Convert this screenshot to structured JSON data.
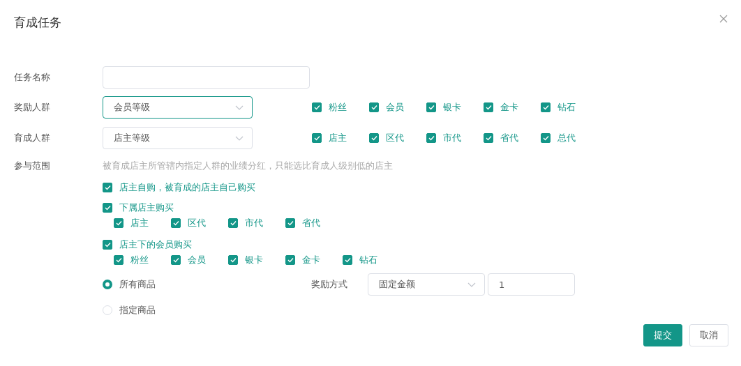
{
  "title": "育成任务",
  "task_name": {
    "label": "任务名称"
  },
  "reward_group": {
    "label": "奖励人群",
    "value": "会员等级",
    "focused": true,
    "options": [
      {
        "label": "粉丝",
        "checked": true
      },
      {
        "label": "会员",
        "checked": true
      },
      {
        "label": "银卡",
        "checked": true
      },
      {
        "label": "金卡",
        "checked": true
      },
      {
        "label": "钻石",
        "checked": true
      }
    ]
  },
  "cultivate_group": {
    "label": "育成人群",
    "value": "店主等级",
    "focused": false,
    "options": [
      {
        "label": "店主",
        "checked": true
      },
      {
        "label": "区代",
        "checked": true
      },
      {
        "label": "市代",
        "checked": true
      },
      {
        "label": "省代",
        "checked": true
      },
      {
        "label": "总代",
        "checked": true
      }
    ]
  },
  "scope": {
    "label": "参与范围",
    "hint": "被育成店主所管辖内指定人群的业绩分红，只能选比育成人级别低的店主",
    "items": [
      {
        "label": "店主自购，被育成的店主自己购买",
        "checked": true
      },
      {
        "label": "下属店主购买",
        "checked": true,
        "children": [
          {
            "label": "店主",
            "checked": true
          },
          {
            "label": "区代",
            "checked": true
          },
          {
            "label": "市代",
            "checked": true
          },
          {
            "label": "省代",
            "checked": true
          }
        ]
      },
      {
        "label": "店主下的会员购买",
        "checked": true,
        "children": [
          {
            "label": "粉丝",
            "checked": true
          },
          {
            "label": "会员",
            "checked": true
          },
          {
            "label": "银卡",
            "checked": true
          },
          {
            "label": "金卡",
            "checked": true
          },
          {
            "label": "钻石",
            "checked": true
          }
        ]
      }
    ]
  },
  "products": [
    {
      "label": "所有商品",
      "selected": true
    },
    {
      "label": "指定商品",
      "selected": false
    }
  ],
  "reward_method": {
    "label": "奖励方式",
    "value": "固定金额",
    "amount": "1"
  },
  "buttons": [
    {
      "label": "提交",
      "kind": "primary"
    },
    {
      "label": "取消",
      "kind": "default"
    }
  ]
}
